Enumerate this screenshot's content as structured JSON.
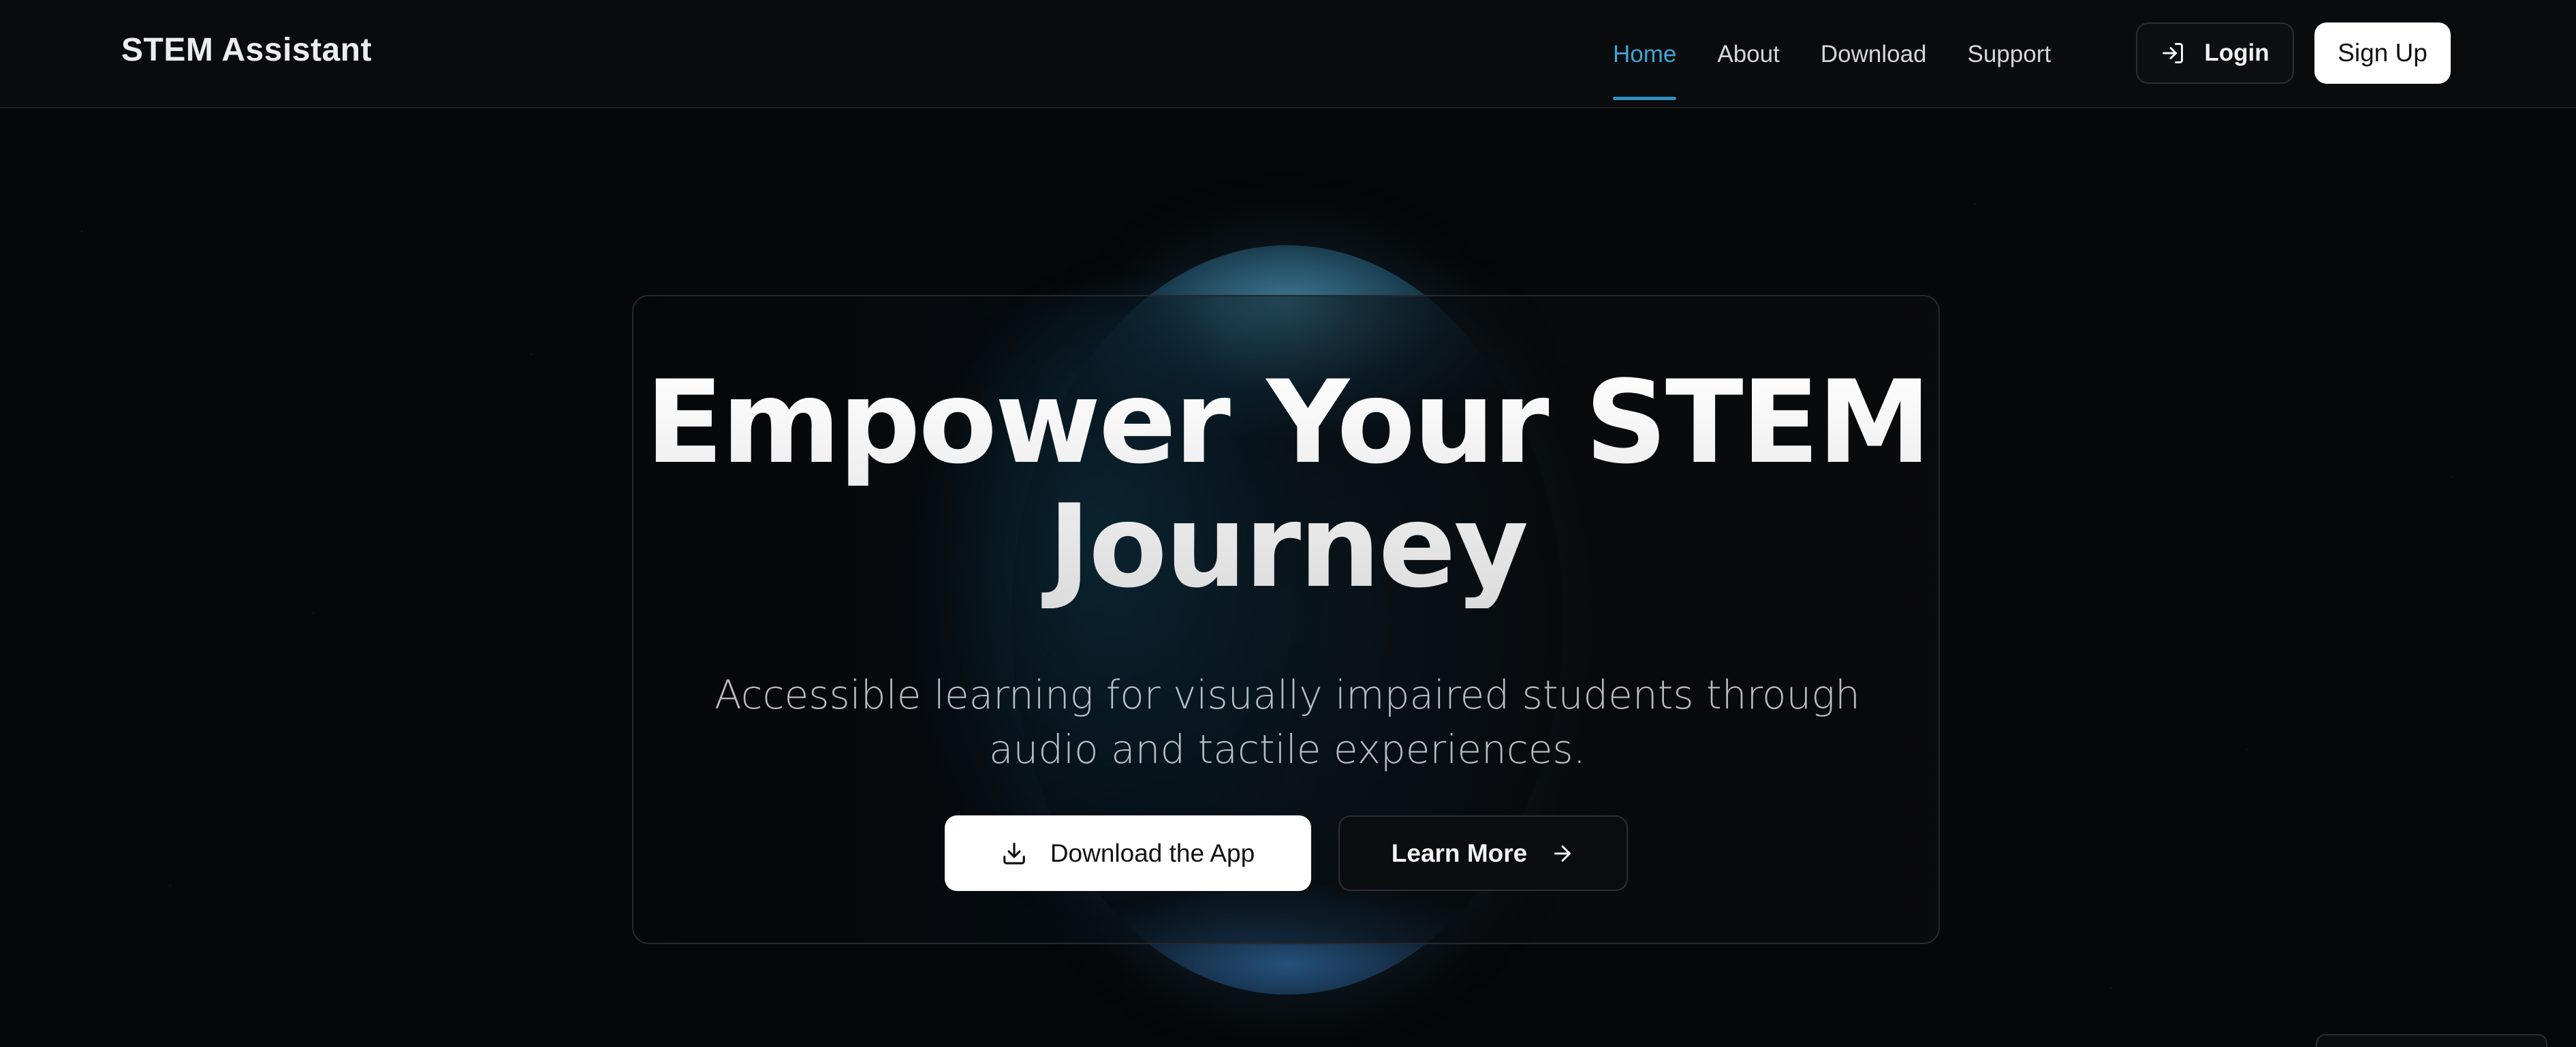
{
  "header": {
    "brand": "STEM Assistant",
    "nav": [
      {
        "label": "Home",
        "active": true
      },
      {
        "label": "About",
        "active": false
      },
      {
        "label": "Download",
        "active": false
      },
      {
        "label": "Support",
        "active": false
      }
    ],
    "login_label": "Login",
    "login_icon": "login-icon",
    "signup_label": "Sign Up"
  },
  "hero": {
    "title": "Empower Your STEM Journey",
    "subtitle": "Accessible learning for visually impaired students through audio and tactile experiences.",
    "primary_button": {
      "label": "Download the App",
      "icon": "download-icon"
    },
    "secondary_button": {
      "label": "Learn More",
      "icon": "arrow-right-icon"
    }
  },
  "colors": {
    "accent": "#3fa6d6",
    "background": "#060708",
    "header_bg": "#0a0b0d",
    "primary_button_bg": "#ffffff"
  }
}
